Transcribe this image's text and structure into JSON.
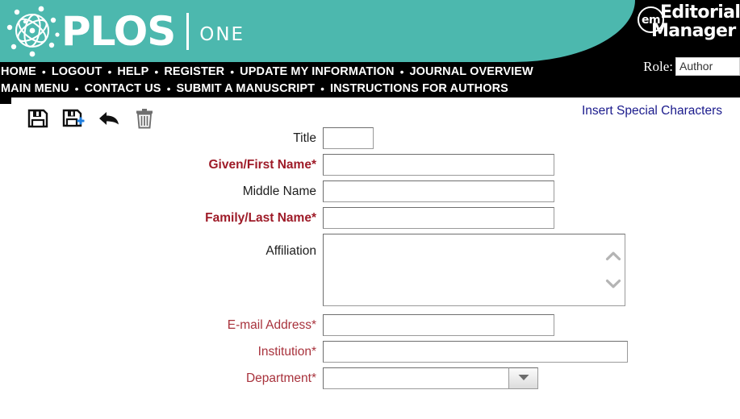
{
  "header": {
    "brand_primary": "PLOS",
    "brand_secondary": "ONE",
    "brand_logo_icon": "plos-orb-icon",
    "em_mark": "em",
    "em_line1": "Editorial",
    "em_line2": "Manager",
    "role_label": "Role:",
    "role_value": "Author",
    "teal_color": "#4cb8ae",
    "nav_bg_color": "#000000"
  },
  "nav": {
    "row1": [
      {
        "label": "HOME"
      },
      {
        "label": "LOGOUT"
      },
      {
        "label": "HELP"
      },
      {
        "label": "REGISTER"
      },
      {
        "label": "UPDATE MY INFORMATION"
      },
      {
        "label": "JOURNAL OVERVIEW"
      }
    ],
    "row2": [
      {
        "label": "MAIN MENU"
      },
      {
        "label": "CONTACT US"
      },
      {
        "label": "SUBMIT A MANUSCRIPT"
      },
      {
        "label": "INSTRUCTIONS FOR AUTHORS"
      }
    ],
    "separator": "•"
  },
  "toolbar": {
    "icons": [
      {
        "name": "save-icon",
        "title": "Save"
      },
      {
        "name": "save-and-add-icon",
        "title": "Save and Add Another"
      },
      {
        "name": "back-arrow-icon",
        "title": "Back"
      },
      {
        "name": "trash-icon",
        "title": "Delete"
      }
    ],
    "special_characters_link": "Insert Special Characters",
    "special_characters_color": "#1a1a8c"
  },
  "form": {
    "required_bold_color": "#9e1b28",
    "required_light_color": "#a8323c",
    "optional_color": "#1d1d1d",
    "fields": {
      "title": {
        "label": "Title",
        "value": "",
        "placeholder": ""
      },
      "given_name": {
        "label": "Given/First Name*",
        "value": "",
        "placeholder": ""
      },
      "middle_name": {
        "label": "Middle Name",
        "value": "",
        "placeholder": ""
      },
      "family_name": {
        "label": "Family/Last Name*",
        "value": "",
        "placeholder": ""
      },
      "affiliation": {
        "label": "Affiliation",
        "value": "",
        "placeholder": ""
      },
      "email": {
        "label": "E-mail Address*",
        "value": "",
        "placeholder": ""
      },
      "institution": {
        "label": "Institution*",
        "value": "",
        "placeholder": ""
      },
      "department": {
        "label": "Department*",
        "value": "",
        "placeholder": "",
        "dropdown_icon": "chevron-down-icon"
      }
    },
    "scroll_up_icon": "chevron-up-icon",
    "scroll_down_icon": "chevron-down-icon"
  }
}
